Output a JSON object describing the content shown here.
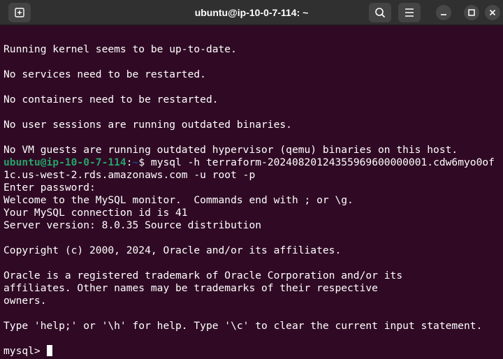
{
  "window": {
    "title": "ubuntu@ip-10-0-7-114: ~",
    "background": "#300a24",
    "icons": {
      "new_tab": "new-tab-icon",
      "search": "search-icon",
      "menu": "hamburger-menu-icon",
      "minimize": "minimize-icon",
      "maximize": "maximize-icon",
      "close": "close-icon"
    }
  },
  "terminal": {
    "lines": [
      "Running kernel seems to be up-to-date.",
      "",
      "No services need to be restarted.",
      "",
      "No containers need to be restarted.",
      "",
      "No user sessions are running outdated binaries.",
      "",
      "No VM guests are running outdated hypervisor (qemu) binaries on this host."
    ],
    "prompt": {
      "user_host": "ubuntu@ip-10-0-7-114",
      "separator": ":",
      "path": "~",
      "symbol": "$ ",
      "command": "mysql -h terraform-20240820124355969600000001.cdw6myo0of"
    },
    "output": [
      "1c.us-west-2.rds.amazonaws.com -u root -p",
      "Enter password:",
      "Welcome to the MySQL monitor.  Commands end with ; or \\g.",
      "Your MySQL connection id is 41",
      "Server version: 8.0.35 Source distribution",
      "",
      "Copyright (c) 2000, 2024, Oracle and/or its affiliates.",
      "",
      "Oracle is a registered trademark of Oracle Corporation and/or its",
      "affiliates. Other names may be trademarks of their respective",
      "owners.",
      "",
      "Type 'help;' or '\\h' for help. Type '\\c' to clear the current input statement.",
      ""
    ],
    "mysql_prompt": "mysql> "
  }
}
